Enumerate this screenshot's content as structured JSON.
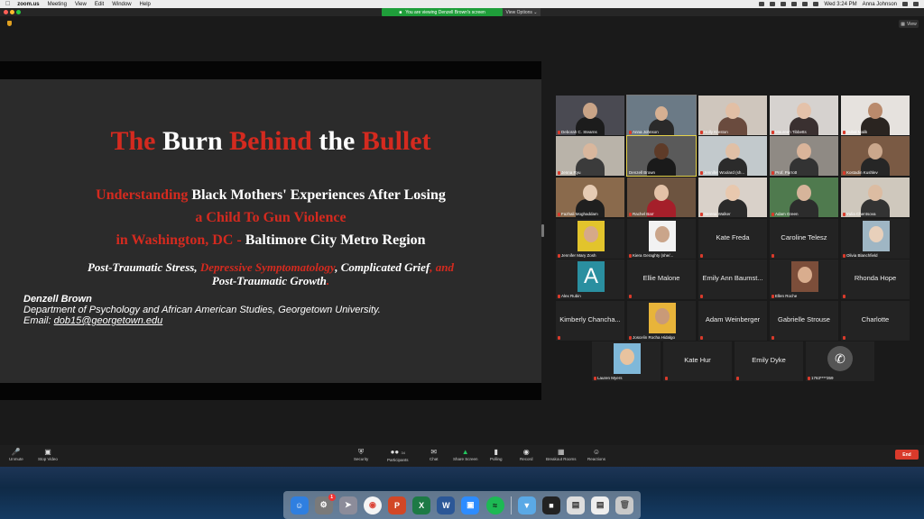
{
  "menubar": {
    "app_name": "zoom.us",
    "items": [
      "Meeting",
      "View",
      "Edit",
      "Window",
      "Help"
    ],
    "clock": "Wed 3:24 PM",
    "user": "Anna Johnson"
  },
  "banner": {
    "text": "You are viewing Denzell Brown's screen",
    "view_options": "View Options"
  },
  "view_button": "View",
  "slide": {
    "title_part1": "The",
    "title_part2": "Burn",
    "title_part3": "Behind",
    "title_part4": "the",
    "title_part5": "Bullet",
    "line1_red": "Understanding",
    "line1_white": "Black Mothers",
    "line1_white2": "' Experiences After Losing",
    "line2_red": "a Child To Gun Violence",
    "line3_red": "in Washington, DC -",
    "line3_white": "Baltimore  City Metro Region",
    "topics_a": "Post-Traumatic Stress,",
    "topics_b": "Depressive Symptomatology",
    "topics_c": ", Complicated Grief",
    "topics_d": ", and",
    "topics_e": "Post-Traumatic Growth",
    "topics_f": ".",
    "author": "Denzell Brown",
    "department": "Department of Psychology and African American Studies, Georgetown University.",
    "email_label": "Email:",
    "email": "dob15@georgetown.edu"
  },
  "gallery": {
    "row1": [
      "Deborah C. Stearns",
      "Anna Johnson",
      "Holly Kreston",
      "Maureen Tibbetts",
      "Subal Malik"
    ],
    "row2": [
      "Jenna Ryu",
      "Denzell Brown",
      "Jennifer Woolard (sh...",
      "Prof. Parrott",
      "Kostadin Kushlev"
    ],
    "row3": [
      "Fazhali Moghaddam",
      "Rachel Barr",
      "Serena Walker",
      "Adam Green",
      "Yulia Chentsova"
    ],
    "row4": [
      "Jennifer Mary Zosh",
      "Kiera Geraghty (she/...",
      "Kate Freda",
      "Caroline Telesz",
      "Olivia Blanchfield"
    ],
    "row5": [
      "Alex Rubin",
      "Ellie Malone",
      "Emily Ann Baumst...",
      "Ellen Roche",
      "Rhonda Hope"
    ],
    "row6": [
      "Kimberly Chancha...",
      "Joscelin Rocha Hidalgo",
      "Adam Weinberger",
      "Gabrielle Strouse",
      "Charlotte"
    ],
    "row7": [
      "Lauren Myers",
      "Kate Hur",
      "Emily Dyke",
      "1763****359"
    ],
    "avatar_letter": "A"
  },
  "toolbar": {
    "unmute": "Unmute",
    "stop_video": "Stop Video",
    "security": "Security",
    "participants": "Participants",
    "participants_count": "34",
    "chat": "Chat",
    "share_screen": "Share Screen",
    "polling": "Polling",
    "record": "Record",
    "breakout": "Breakout Rooms",
    "reactions": "Reactions",
    "end": "End"
  },
  "dock_badge": "1",
  "colors": {
    "accent_red": "#d42a1f",
    "zoom_green": "#1f9e3a",
    "end_red": "#d93a2b"
  }
}
